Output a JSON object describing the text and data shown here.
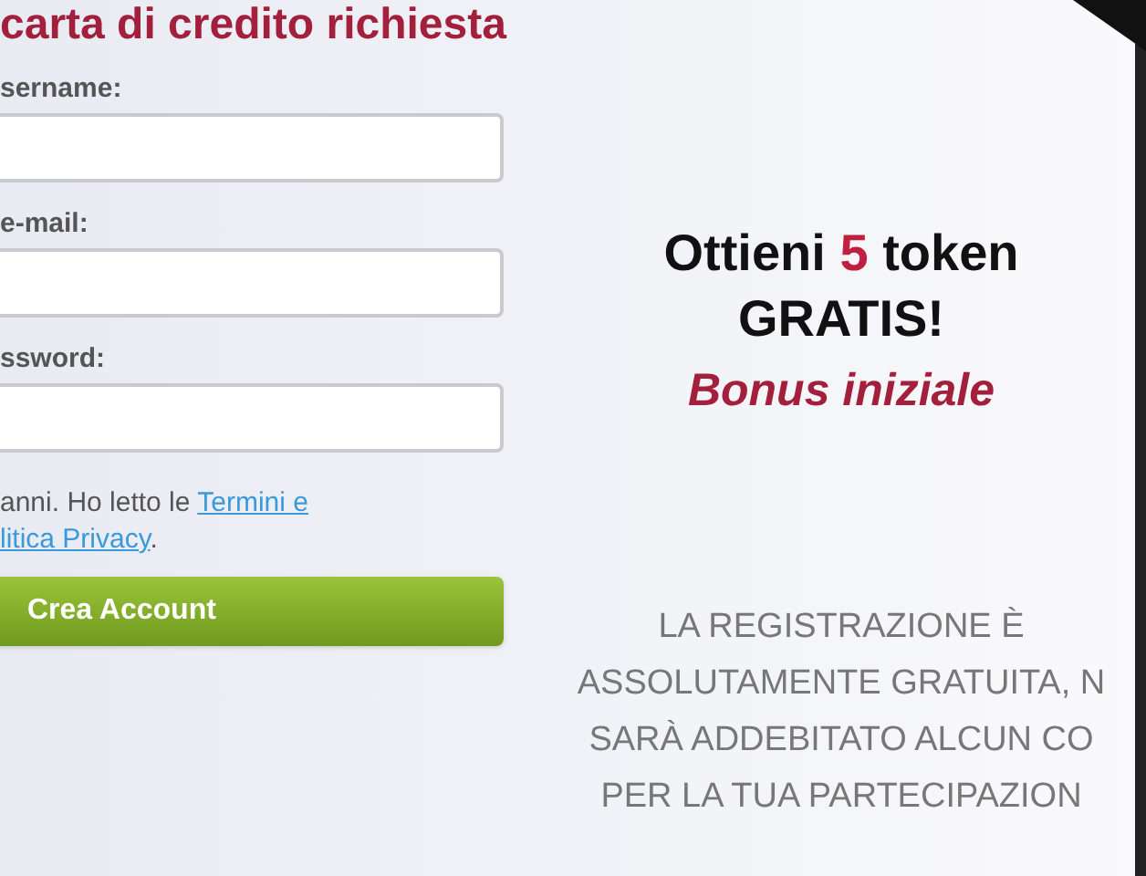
{
  "form": {
    "heading": "carta di credito richiesta",
    "fields": [
      {
        "label": "sername:"
      },
      {
        "label": "e-mail:"
      },
      {
        "label": "ssword:"
      }
    ],
    "terms": {
      "lines": [
        {
          "text": "anni. Ho letto le ",
          "link": "Termini e"
        },
        {
          "link": "litica Privacy",
          "tail": "."
        }
      ]
    },
    "submit": "Crea Account"
  },
  "promo": {
    "offer": {
      "before": "Ottieni",
      "number": "5",
      "after": "token"
    },
    "headline": "GRATIS!",
    "bonus": "Bonus iniziale",
    "notice": [
      "LA REGISTRAZIONE È",
      "ASSOLUTAMENTE GRATUITA, N",
      "SARÀ ADDEBITATO ALCUN CO",
      "PER LA TUA PARTECIPAZION"
    ]
  }
}
